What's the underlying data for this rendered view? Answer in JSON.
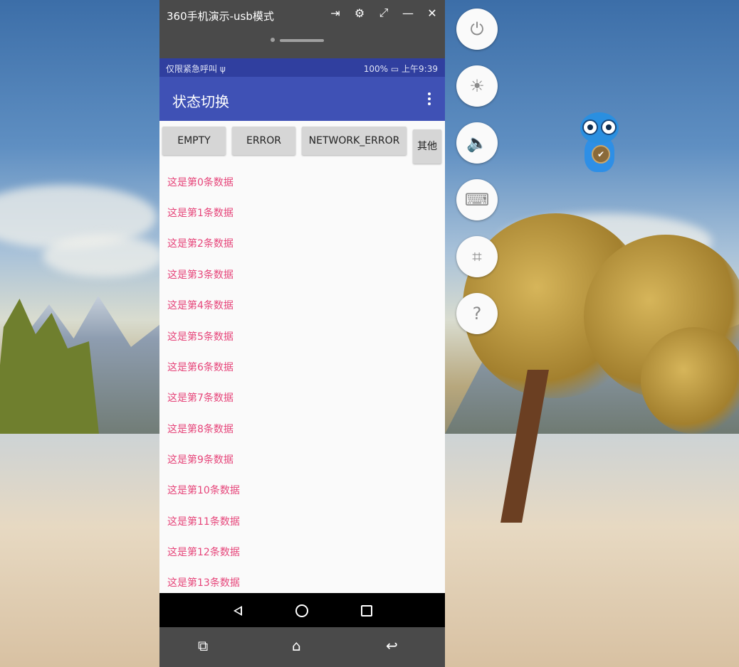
{
  "window": {
    "title": "360手机演示-usb模式",
    "icons": [
      "exit-fullscreen-icon",
      "settings-icon",
      "expand-icon",
      "minimize-icon",
      "close-icon"
    ]
  },
  "status_bar": {
    "left": "仅限紧急呼叫 ψ",
    "right": "100% ▭ 上午9:39",
    "bg_color": "#303f9f"
  },
  "app_bar": {
    "title": "状态切换",
    "bg_color": "#3f51b5"
  },
  "buttons": [
    {
      "label": "EMPTY"
    },
    {
      "label": "ERROR"
    },
    {
      "label": "NETWORK_ERROR"
    },
    {
      "label": "其他"
    }
  ],
  "list": {
    "text_color": "#e6457a",
    "items": [
      "这是第0条数据",
      "这是第1条数据",
      "这是第2条数据",
      "这是第3条数据",
      "这是第4条数据",
      "这是第5条数据",
      "这是第6条数据",
      "这是第7条数据",
      "这是第8条数据",
      "这是第9条数据",
      "这是第10条数据",
      "这是第11条数据",
      "这是第12条数据",
      "这是第13条数据"
    ]
  },
  "side_controls": [
    {
      "name": "power-icon",
      "glyph": "⏻"
    },
    {
      "name": "brightness-icon",
      "glyph": "☀"
    },
    {
      "name": "volume-icon",
      "glyph": "🔈"
    },
    {
      "name": "keyboard-icon",
      "glyph": "⌨"
    },
    {
      "name": "crop-icon",
      "glyph": "⌗"
    },
    {
      "name": "help-icon",
      "glyph": "?"
    }
  ]
}
